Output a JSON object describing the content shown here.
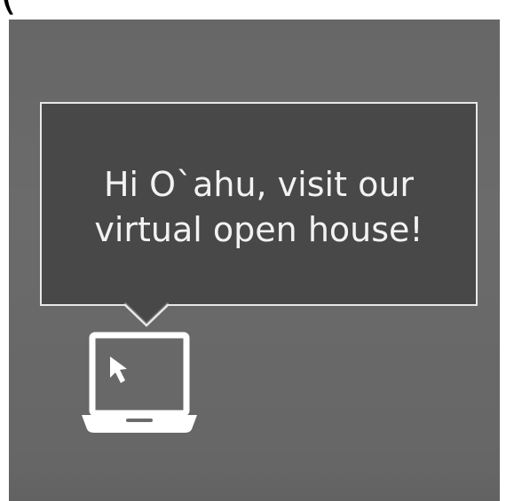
{
  "top_text": "(                                        ,       )",
  "message": {
    "line1": "Hi O`ahu, visit our",
    "line2": "virtual open house!"
  },
  "colors": {
    "panel": "#6b6b6b",
    "bubble": "#484848",
    "bubble_border": "#e8e8e8",
    "text": "#f2f2f2",
    "icon": "#ffffff"
  },
  "icons": {
    "laptop": "laptop-icon",
    "cursor": "cursor-arrow-icon"
  }
}
